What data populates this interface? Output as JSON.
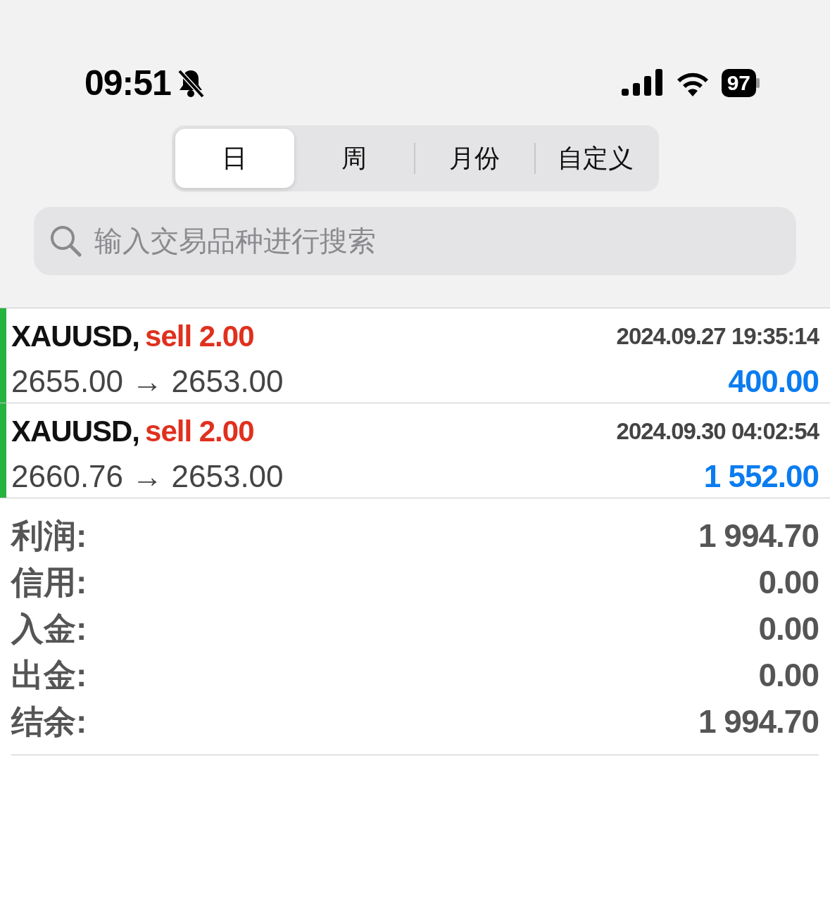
{
  "status_bar": {
    "time": "09:51",
    "battery": "97"
  },
  "tabs": [
    {
      "label": "日",
      "selected": true
    },
    {
      "label": "周",
      "selected": false
    },
    {
      "label": "月份",
      "selected": false
    },
    {
      "label": "自定义",
      "selected": false
    }
  ],
  "search": {
    "placeholder": "输入交易品种进行搜索"
  },
  "trades": [
    {
      "symbol": "XAUUSD,",
      "order": "sell 2.00",
      "kind": "sell",
      "time": "2024.09.27 19:35:14",
      "prices": "2655.00 → 2653.00",
      "profit": "400.00"
    },
    {
      "symbol": "XAUUSD,",
      "order": "sell 2.00",
      "kind": "sell",
      "time": "2024.09.30 04:02:54",
      "prices": "2660.76 → 2653.00",
      "profit": "1 552.00"
    }
  ],
  "summary": [
    {
      "label": "利润:",
      "value": "1 994.70"
    },
    {
      "label": "信用:",
      "value": "0.00"
    },
    {
      "label": "入金:",
      "value": "0.00"
    },
    {
      "label": "出金:",
      "value": "0.00"
    },
    {
      "label": "结余:",
      "value": "1 994.70"
    }
  ]
}
